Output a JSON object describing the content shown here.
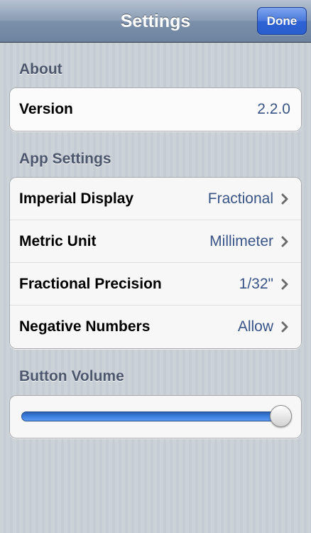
{
  "navbar": {
    "title": "Settings",
    "done_label": "Done"
  },
  "sections": {
    "about": {
      "header": "About",
      "rows": [
        {
          "label": "Version",
          "value": "2.2.0"
        }
      ]
    },
    "app_settings": {
      "header": "App Settings",
      "rows": [
        {
          "label": "Imperial Display",
          "value": "Fractional",
          "icon": "chevron-right-icon"
        },
        {
          "label": "Metric Unit",
          "value": "Millimeter",
          "icon": "chevron-right-icon"
        },
        {
          "label": "Fractional Precision",
          "value": "1/32\"",
          "icon": "chevron-right-icon"
        },
        {
          "label": "Negative Numbers",
          "value": "Allow",
          "icon": "chevron-right-icon"
        }
      ]
    },
    "button_volume": {
      "header": "Button Volume",
      "level": 1.0
    }
  },
  "colors": {
    "nav_bar": "#7c90aa",
    "done_button": "#2f62d2",
    "section_header": "#4c566c",
    "detail_value": "#385487",
    "slider_fill": "#3d7ee0"
  }
}
